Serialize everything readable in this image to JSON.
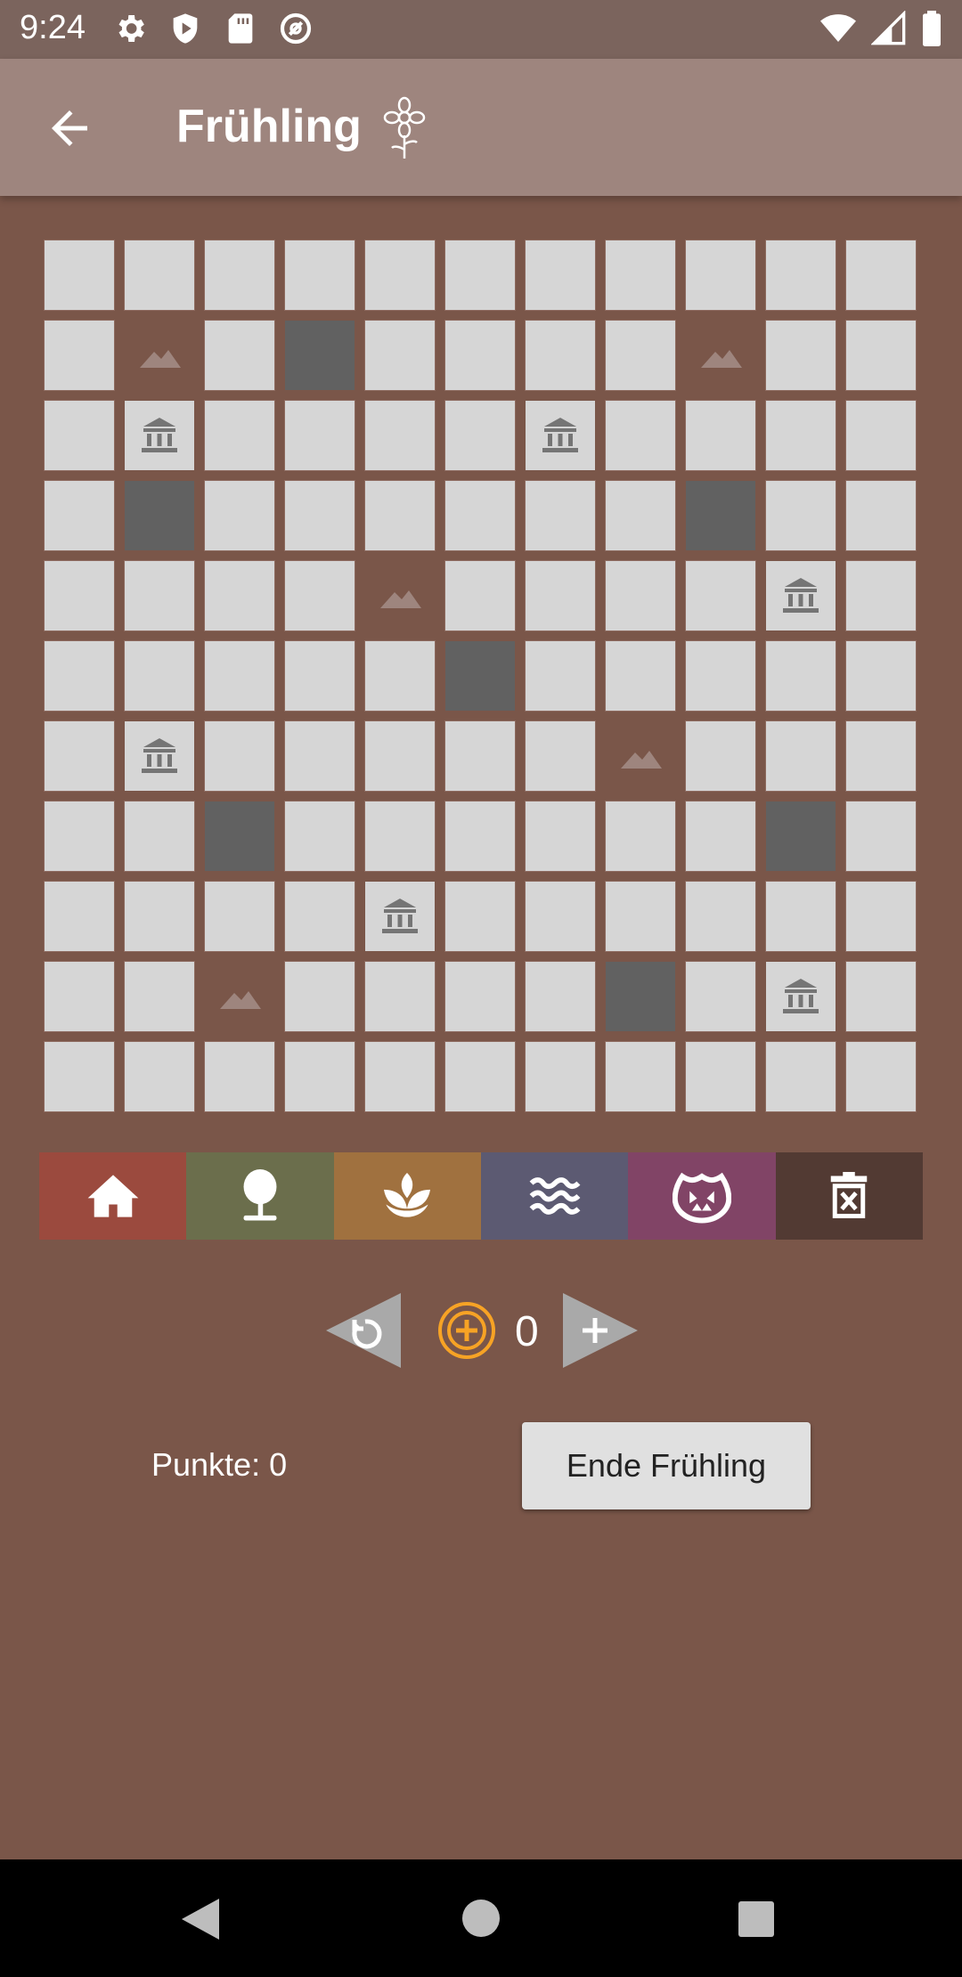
{
  "status_bar": {
    "time": "9:24"
  },
  "app_bar": {
    "title": "Frühling"
  },
  "board": {
    "rows": 11,
    "cols": 11,
    "grid": [
      "...........",
      ".M.D....M..",
      ".R....R....",
      ".D......D..",
      "....M....R.",
      ".....D.....",
      ".R.....M...",
      "..D......D.",
      "....R......",
      "..M....D.R.",
      "..........."
    ],
    "legend": {
      ".": "empty",
      "M": "mountain",
      "R": "ruin",
      "D": "blocked"
    }
  },
  "palette": {
    "items": [
      {
        "name": "village",
        "icon": "house-icon",
        "color": "#9b4a3e"
      },
      {
        "name": "forest",
        "icon": "tree-icon",
        "color": "#6b6e4c"
      },
      {
        "name": "farm",
        "icon": "sprout-icon",
        "color": "#a0713f"
      },
      {
        "name": "water",
        "icon": "waves-icon",
        "color": "#5c5a72"
      },
      {
        "name": "monster",
        "icon": "monster-icon",
        "color": "#814466"
      },
      {
        "name": "delete",
        "icon": "trash-icon",
        "color": "#523a33"
      }
    ]
  },
  "coins": {
    "count": "0"
  },
  "score": {
    "label": "Punkte: 0"
  },
  "end_button": {
    "label": "Ende Frühling"
  },
  "colors": {
    "background": "#7a5649",
    "appbar": "#9e857e",
    "statusbar": "#7b645d",
    "coin": "#f7a325"
  }
}
